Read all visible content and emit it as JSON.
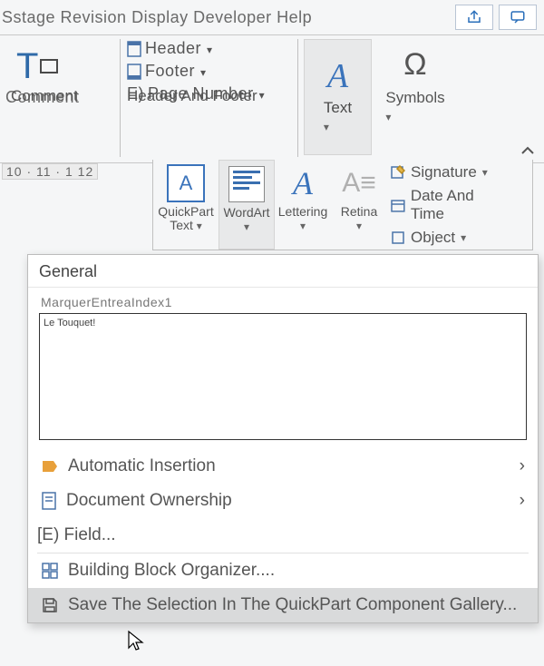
{
  "menubar": {
    "items_text": "Sstage Revision Display Developer Help",
    "share_icon": "share-icon",
    "comments_icon": "comments-icon"
  },
  "ribbon": {
    "comment": {
      "button_label": "Comment",
      "group_title": "Comment"
    },
    "header_footer": {
      "header": "Header",
      "footer": "Footer",
      "page_number_prefix": "E)",
      "page_number": "Page Number",
      "group_title": "Header And Footer"
    },
    "text": {
      "label": "Text"
    },
    "symbols": {
      "label": "Symbols"
    }
  },
  "ruler": "10 · 11 · 1 12",
  "subribbon": {
    "quickpart": {
      "label": "QuickPart",
      "sublabel": "Text"
    },
    "wordart": {
      "label": "WordArt"
    },
    "lettering": {
      "label": "Lettering"
    },
    "retina": {
      "label": "Retina"
    },
    "signature": "Signature",
    "date_time": "Date And Time",
    "object": "Object"
  },
  "menu": {
    "general": "General",
    "entry_name": "MarquerEntreaIndex1",
    "preview_text": "Le Touquet!",
    "automatic_insertion": "Automatic Insertion",
    "document_ownership": "Document Ownership",
    "field": "[E) Field...",
    "building_block": "Building Block Organizer....",
    "save_selection": "Save The Selection In The QuickPart Component Gallery..."
  }
}
